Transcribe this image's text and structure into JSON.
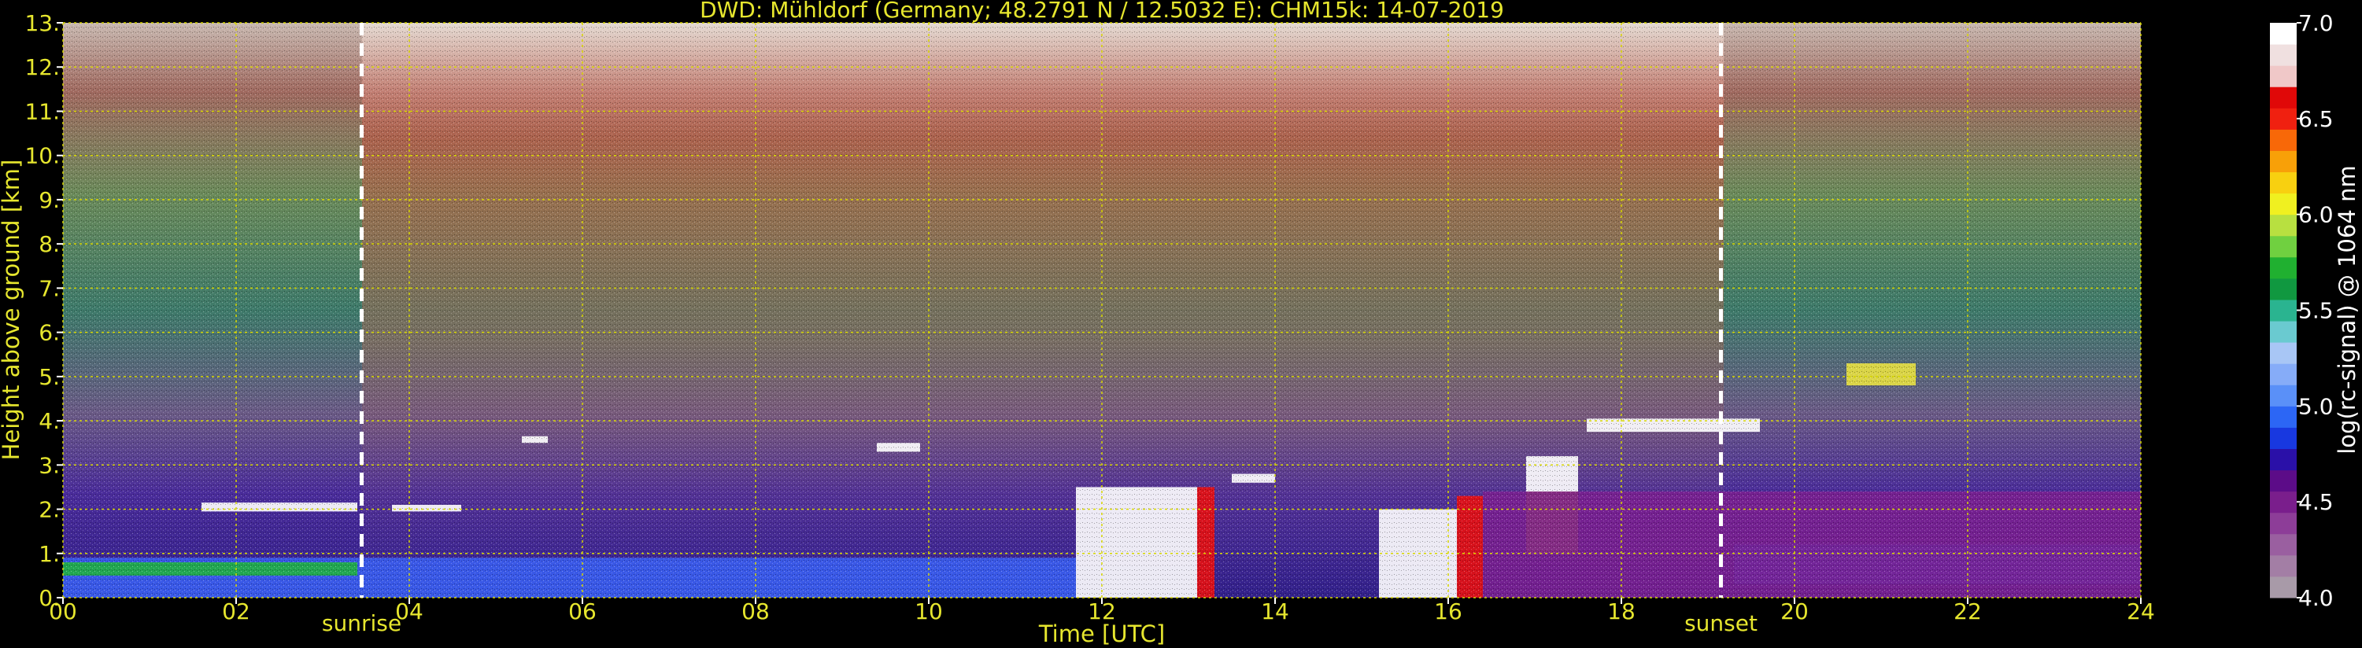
{
  "chart_data": {
    "type": "heatmap",
    "title": "DWD: Mühldorf (Germany; 48.2791 N / 12.5032 E):    CHM15k: 14-07-2019",
    "xlabel": "Time [UTC]",
    "ylabel": "Height above ground [km]",
    "xlim": [
      0,
      24
    ],
    "ylim": [
      0,
      13
    ],
    "x_ticks": [
      0,
      2,
      4,
      6,
      8,
      10,
      12,
      14,
      16,
      18,
      20,
      22,
      24
    ],
    "x_tick_labels": [
      "00",
      "02",
      "04",
      "06",
      "08",
      "10",
      "12",
      "14",
      "16",
      "18",
      "20",
      "22",
      "24"
    ],
    "y_ticks": [
      0,
      1,
      2,
      3,
      4,
      5,
      6,
      7,
      8,
      9,
      10,
      11,
      12,
      13
    ],
    "y_tick_labels": [
      "0.",
      "1.",
      "2.",
      "3.",
      "4.",
      "5.",
      "6.",
      "7.",
      "8.",
      "9.",
      "10.",
      "11.",
      "12.",
      "13."
    ],
    "grid": true,
    "grid_color": "#d8d800",
    "text_color": "#e6e62e",
    "markers": [
      {
        "label": "sunrise",
        "x": 3.45
      },
      {
        "label": "sunset",
        "x": 19.15
      }
    ],
    "colorbar": {
      "label": "log(rc-signal) @ 1064 nm",
      "range": [
        4.0,
        7.0
      ],
      "ticks": [
        4.0,
        4.5,
        5.0,
        5.5,
        6.0,
        6.5,
        7.0
      ],
      "tick_labels": [
        "4.0",
        "4.5",
        "5.0",
        "5.5",
        "6.0",
        "6.5",
        "7.0"
      ],
      "colors": [
        "#a89aa8",
        "#a37ea5",
        "#9a5fa0",
        "#8d3d98",
        "#7a1e8c",
        "#5c0c88",
        "#2a10a8",
        "#1838e0",
        "#2c66f5",
        "#5a90f8",
        "#86acf8",
        "#a8c6f5",
        "#6acad0",
        "#2ab490",
        "#109840",
        "#20b030",
        "#70d040",
        "#b8e040",
        "#f0f020",
        "#f8d010",
        "#f8a008",
        "#f86808",
        "#f02010",
        "#e00808",
        "#f0c8c8",
        "#f0e0e0",
        "#ffffff"
      ]
    },
    "layers": [
      {
        "name": "cloud",
        "color": "#ffffff",
        "x0": 1.6,
        "x1": 3.4,
        "y0": 1.95,
        "y1": 2.15
      },
      {
        "name": "cloud",
        "color": "#ffffff",
        "x0": 3.8,
        "x1": 4.6,
        "y0": 1.95,
        "y1": 2.1
      },
      {
        "name": "cloud",
        "color": "#ffffff",
        "x0": 5.3,
        "x1": 5.6,
        "y0": 3.5,
        "y1": 3.65
      },
      {
        "name": "cloud",
        "color": "#ffffff",
        "x0": 9.4,
        "x1": 9.9,
        "y0": 3.3,
        "y1": 3.5
      },
      {
        "name": "cloud",
        "color": "#ffffff",
        "x0": 13.5,
        "x1": 14.0,
        "y0": 2.6,
        "y1": 2.8
      },
      {
        "name": "cloud",
        "color": "#ffffff",
        "x0": 17.6,
        "x1": 19.6,
        "y0": 3.75,
        "y1": 4.05
      },
      {
        "name": "convective",
        "color": "#ffffff",
        "x0": 11.7,
        "x1": 13.1,
        "y0": 0.0,
        "y1": 2.5
      },
      {
        "name": "convective",
        "color": "#e81010",
        "x0": 13.1,
        "x1": 13.3,
        "y0": 0.0,
        "y1": 2.5
      },
      {
        "name": "convective",
        "color": "#ffffff",
        "x0": 15.2,
        "x1": 16.1,
        "y0": 0.0,
        "y1": 2.0
      },
      {
        "name": "convective",
        "color": "#e81010",
        "x0": 16.1,
        "x1": 16.4,
        "y0": 0.0,
        "y1": 2.3
      },
      {
        "name": "convective",
        "color": "#ffffff",
        "x0": 16.9,
        "x1": 17.5,
        "y0": 2.4,
        "y1": 3.2
      },
      {
        "name": "convective",
        "color": "#f0a010",
        "x0": 16.9,
        "x1": 17.5,
        "y0": 1.0,
        "y1": 2.4
      },
      {
        "name": "boundary-layer",
        "color": "#3a5ef0",
        "x0": 0.0,
        "x1": 11.7,
        "y0": 0.0,
        "y1": 0.9
      },
      {
        "name": "boundary-layer",
        "color": "#20b040",
        "x0": 0.0,
        "x1": 3.4,
        "y0": 0.5,
        "y1": 0.8
      },
      {
        "name": "boundary-layer",
        "color": "#3a5ef0",
        "x0": 19.3,
        "x1": 24.0,
        "y0": 0.3,
        "y1": 1.2
      },
      {
        "name": "boundary-layer",
        "color": "#7a2090",
        "x0": 16.4,
        "x1": 24.0,
        "y0": 0.0,
        "y1": 2.4
      },
      {
        "name": "aerosol",
        "color": "#e8e040",
        "x0": 20.6,
        "x1": 21.4,
        "y0": 4.8,
        "y1": 5.3
      }
    ]
  }
}
